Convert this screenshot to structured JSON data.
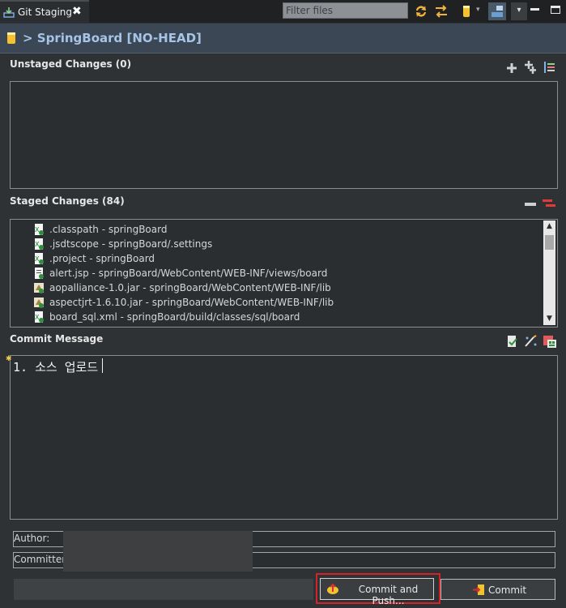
{
  "view_tab": {
    "label": "Git Staging",
    "close": "✖"
  },
  "toolbar": {
    "filter_placeholder": "Filter files",
    "menu_chevron": "▾"
  },
  "repo": {
    "title": "> SpringBoard [NO-HEAD]"
  },
  "unstaged": {
    "title": "Unstaged Changes (0)"
  },
  "staged": {
    "title": "Staged Changes (84)",
    "items": [
      {
        "name": ".classpath - springBoard",
        "icon": "xml-file-icon"
      },
      {
        "name": ".jsdtscope - springBoard/.settings",
        "icon": "xml-file-icon"
      },
      {
        "name": ".project - springBoard",
        "icon": "xml-file-icon"
      },
      {
        "name": "alert.jsp - springBoard/WebContent/WEB-INF/views/board",
        "icon": "jsp-file-icon"
      },
      {
        "name": "aopalliance-1.0.jar - springBoard/WebContent/WEB-INF/lib",
        "icon": "jar-file-icon"
      },
      {
        "name": "aspectjrt-1.6.10.jar - springBoard/WebContent/WEB-INF/lib",
        "icon": "jar-file-icon"
      },
      {
        "name": "board_sql.xml - springBoard/build/classes/sql/board",
        "icon": "xml-file-icon"
      }
    ]
  },
  "commit_message": {
    "title": "Commit Message",
    "text": "1. 소스 업로드"
  },
  "author": {
    "label": "Author:",
    "value": ""
  },
  "committer": {
    "label": "Committer:",
    "value": ""
  },
  "buttons": {
    "commit_and_push": "Commit and Push...",
    "commit": "Commit"
  },
  "colors": {
    "background": "#2f3235",
    "header": "#3b4754",
    "repo_title": "#a6c5e6",
    "highlight": "#d2222a"
  }
}
